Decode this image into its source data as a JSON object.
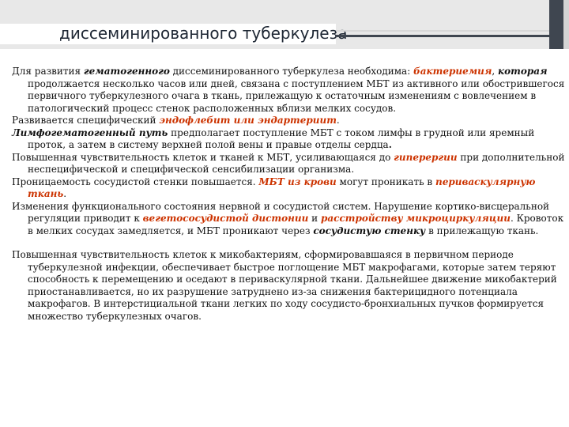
{
  "title": "диссеминированного туберкулеза",
  "paragraphs": [
    [
      {
        "t": "Для развития ",
        "s": ""
      },
      {
        "t": "гематогенного",
        "s": "bi"
      },
      {
        "t": " диссеминированного туберкулеза необходима: ",
        "s": ""
      },
      {
        "t": "бактериемия",
        "s": "red"
      },
      {
        "t": ", ",
        "s": ""
      },
      {
        "t": "которая",
        "s": "bi"
      },
      {
        "t": " продолжается несколько часов или дней, связана с поступлением МБТ из активного или обострившегося первичного туберкулезного очага в ткань, прилежащую к остаточным изменениям с вовлечением в патологический процесс стенок расположенных вблизи мелких сосудов.",
        "s": ""
      }
    ],
    [
      {
        "t": "Развивается специфический ",
        "s": ""
      },
      {
        "t": "эндофлебит или эндартериит",
        "s": "red"
      },
      {
        "t": ".",
        "s": ""
      }
    ],
    [
      {
        "t": "Лимфогематогенный путь",
        "s": "bi"
      },
      {
        "t": "  предполагает  поступление МБТ с током лимфы в грудной или яремный проток, а затем в систему верхней полой вены и правые отделы сердца",
        "s": ""
      },
      {
        "t": ".",
        "s": "b"
      }
    ],
    [
      {
        "t": "Повышенная чувствительность клеток и тканей к МБТ, усиливающаяся до ",
        "s": ""
      },
      {
        "t": "гиперергии",
        "s": "red"
      },
      {
        "t": " при дополнительной неспецифической и специфической сенсибилизации организма.",
        "s": ""
      }
    ],
    [
      {
        "t": " Проницаемость сосудистой стенки повышается. ",
        "s": ""
      },
      {
        "t": "МБТ из крови",
        "s": "red"
      },
      {
        "t": " могут проникать в ",
        "s": ""
      },
      {
        "t": "периваскулярную ткань",
        "s": "red"
      },
      {
        "t": ".",
        "s": ""
      }
    ],
    [
      {
        "t": "Изменения функционального состояния нервной и сосудистой систем. Нарушение кортико-висцеральной регуляции приводит к ",
        "s": ""
      },
      {
        "t": "вегетососудистой дистонии",
        "s": "red"
      },
      {
        "t": " и ",
        "s": ""
      },
      {
        "t": "расстройству микроциркуляции",
        "s": "red"
      },
      {
        "t": ". Кровоток в мелких сосудах замедляется, и МБТ проникают через ",
        "s": ""
      },
      {
        "t": "сосудистую стенку",
        "s": "bi"
      },
      {
        "t": " в прилежащую ткань.",
        "s": ""
      }
    ],
    [
      {
        "t": "Повышенная чувствительность клеток к микобактериям, сформировавшаяся в первичном периоде туберкулезной инфекции, обеспечивает быстрое поглощение МБТ макрофагами, которые затем теряют способность к перемещению и оседают в периваскулярной ткани. Дальнейшее движение микобактерий приостанавливается, но их разрушение затруднено из-за снижения бактерицидного потенциала макрофагов. В интерстициальной ткани легких по ходу сосудисто-бронхиальных пучков формируется множество туберкулезных очагов.",
        "s": ""
      }
    ]
  ]
}
